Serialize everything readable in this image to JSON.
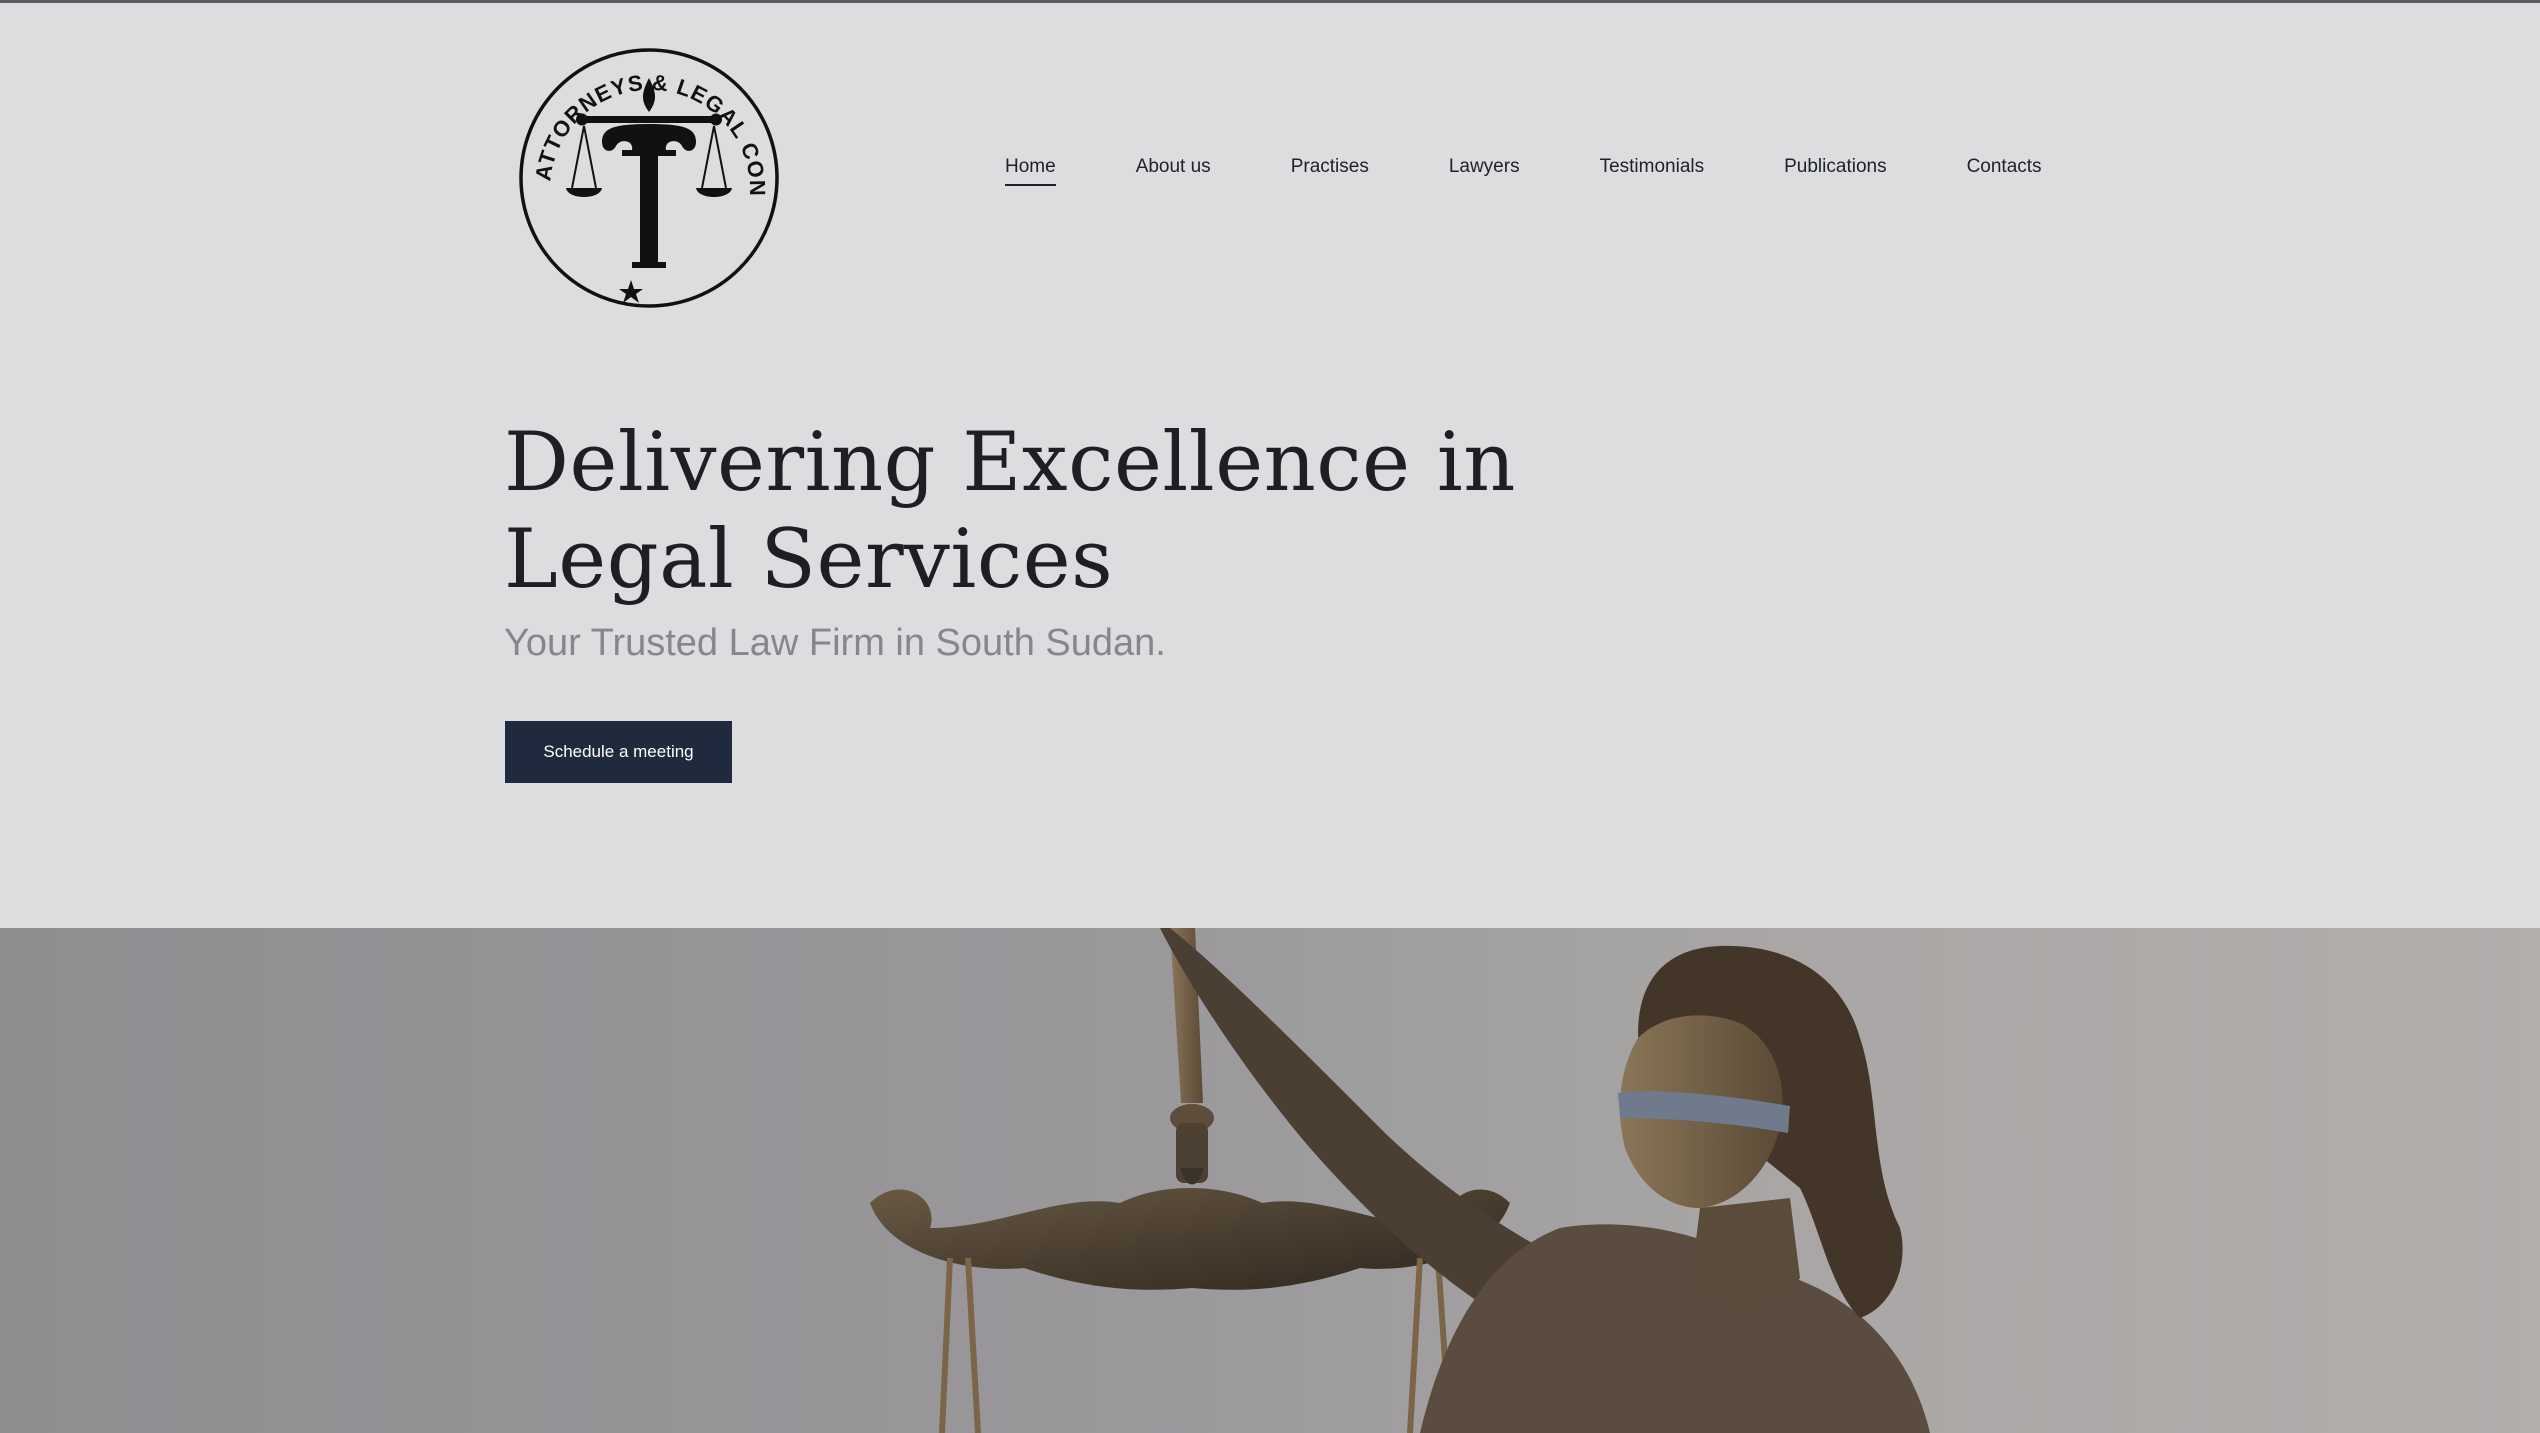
{
  "brand": {
    "logo_text": "ADVANCED ATTORNEYS & LEGAL CONSULTANTS",
    "logo_icon": "scales-of-justice-icon"
  },
  "nav": {
    "items": [
      {
        "label": "Home",
        "active": true
      },
      {
        "label": "About us",
        "active": false
      },
      {
        "label": "Practises",
        "active": false
      },
      {
        "label": "Lawyers",
        "active": false
      },
      {
        "label": "Testimonials",
        "active": false
      },
      {
        "label": "Publications",
        "active": false
      },
      {
        "label": "Contacts",
        "active": false
      }
    ]
  },
  "hero": {
    "title_line1": "Delivering Excellence in",
    "title_line2": "Legal Services",
    "subtitle": "Your Trusted Law Firm in South Sudan.",
    "cta_label": "Schedule a meeting"
  },
  "colors": {
    "background": "#dcdddf",
    "text": "#1e1f23",
    "subtitle": "#86878b",
    "button": "#1f2a3f",
    "button_text": "#ffffff"
  }
}
